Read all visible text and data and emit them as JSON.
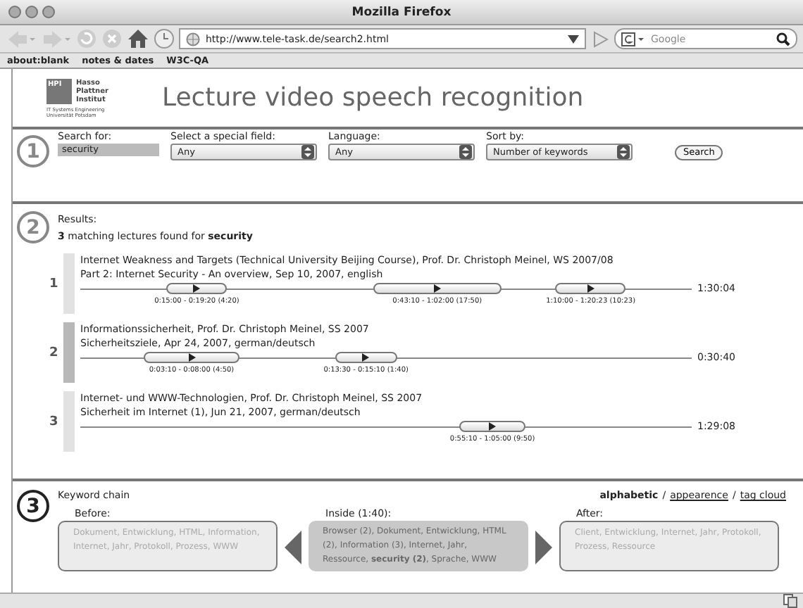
{
  "window": {
    "title": "Mozilla Firefox"
  },
  "toolbar": {
    "url": "http://www.tele-task.de/search2.html",
    "search_placeholder": "Google"
  },
  "bookmarks": [
    "about:blank",
    "notes & dates",
    "W3C-QA"
  ],
  "header": {
    "logo_box": "HPI",
    "logo_lines": [
      "Hasso",
      "Plattner",
      "Institut"
    ],
    "logo_sub": [
      "IT Systems Engineering",
      "Universität Potsdam"
    ],
    "title": "Lecture video speech recognition"
  },
  "search": {
    "step": "1",
    "fields": [
      {
        "kind": "text",
        "label": "Search for:",
        "value": "security"
      },
      {
        "kind": "select",
        "label": "Select a special field:",
        "value": "Any"
      },
      {
        "kind": "select",
        "label": "Language:",
        "value": "Any"
      },
      {
        "kind": "select",
        "label": "Sort by:",
        "value": "Number of keywords"
      }
    ],
    "button": "Search"
  },
  "results": {
    "step": "2",
    "heading": "Results:",
    "summary": "**3** matching lectures found for **security**",
    "items": [
      {
        "number": "1",
        "selected": false,
        "line1": "Internet Weakness and Targets (Technical University Beijing Course), Prof. Dr. Christoph Meinel, WS 2007/08",
        "line2": "Part 2: Internet Security - An overview, Sep 10, 2007, english",
        "duration": "1:30:04",
        "segments": [
          "0:15:00 - 0:19:20 (4:20)",
          "0:43:10 - 1:02:00 (17:50)",
          "1:10:00 - 1:20:23 (10:23)"
        ]
      },
      {
        "number": "2",
        "selected": true,
        "line1": "Informationssicherheit, Prof. Dr. Christoph Meinel, SS 2007",
        "line2": "Sicherheitsziele, Apr 24, 2007, german/deutsch",
        "duration": "0:30:40",
        "segments": [
          "0:03:10 - 0:08:00 (4:50)",
          "0:13:30 - 0:15:10 (1:40)"
        ]
      },
      {
        "number": "3",
        "selected": false,
        "line1": "Internet- und WWW-Technologien, Prof. Dr. Christoph Meinel, SS 2007",
        "line2": "Sicherheit im Internet (1), Jun 21, 2007, german/deutsch",
        "duration": "1:29:08",
        "segments": [
          "0:55:10 - 1:05:00 (9:50)"
        ]
      }
    ]
  },
  "keywords": {
    "step": "3",
    "heading": "Keyword chain",
    "separator": "/",
    "sort_options": [
      {
        "label": "alphabetic",
        "selected": true
      },
      {
        "label": "appearence",
        "selected": false
      },
      {
        "label": "tag cloud",
        "selected": false
      }
    ],
    "before": {
      "label": "Before:",
      "text": "Dokument, Entwicklung, HTML, Information, Internet, Jahr, Protokoll, Prozess, WWW"
    },
    "inside": {
      "label": "Inside (1:40):",
      "text": "Browser (2), Dokument, Entwicklung, HTML (2), Information (3), Internet, Jahr, Ressource, **security (2)**, Sprache, WWW"
    },
    "after": {
      "label": "After:",
      "text": "Client, Entwicklung, Internet, Jahr, Protokoll, Prozess, Ressource"
    }
  }
}
